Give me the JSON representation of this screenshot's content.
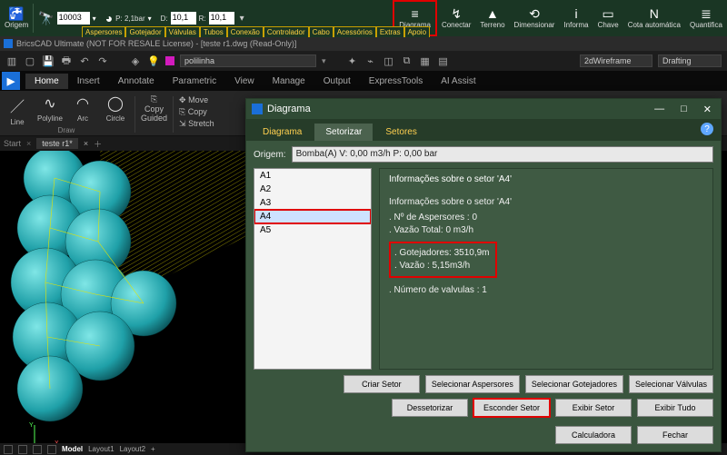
{
  "green_bar": {
    "origem": "Origem",
    "bino_value": "10003",
    "pressure_label": "P: 2,1bar",
    "d_label": "D:",
    "d_value": "10,1",
    "r_label": "R:",
    "r_value": "10,1",
    "yellow_tabs": [
      "Aspersores",
      "Gotejador",
      "Válvulas",
      "Tubos",
      "Conexão",
      "Controlador",
      "Cabo",
      "Acessórios",
      "Extras",
      "Apoio"
    ],
    "right_tools": [
      {
        "label": "Diagrama",
        "icon": "≡"
      },
      {
        "label": "Conectar",
        "icon": "↯"
      },
      {
        "label": "Terreno",
        "icon": "▲"
      },
      {
        "label": "Dimensionar",
        "icon": "⟲"
      },
      {
        "label": "Informa",
        "icon": "i"
      },
      {
        "label": "Chave",
        "icon": "▭"
      },
      {
        "label": "Cota automática",
        "icon": "N"
      },
      {
        "label": "Quantifica",
        "icon": "≣"
      }
    ]
  },
  "title_bar": "BricsCAD Ultimate (NOT FOR RESALE License) - [teste r1.dwg (Read-Only)]",
  "dark_row": {
    "layer_value": "polilinha",
    "style1": "2dWireframe",
    "style2": "Drafting"
  },
  "ribbon_tabs": [
    "Home",
    "Insert",
    "Annotate",
    "Parametric",
    "View",
    "Manage",
    "Output",
    "ExpressTools",
    "AI Assist"
  ],
  "ribbon_active": 0,
  "draw_tools": [
    {
      "label": "Line",
      "icon": "／"
    },
    {
      "label": "Polyline",
      "icon": "∿"
    },
    {
      "label": "Arc",
      "icon": "◠"
    },
    {
      "label": "Circle",
      "icon": "◯"
    }
  ],
  "draw_group_label": "Draw",
  "copy_guided": "Copy\nGuided",
  "modify_items": [
    "Move",
    "Copy",
    "Stretch"
  ],
  "doc_tabs": {
    "start": "Start",
    "file": "teste r1*"
  },
  "status_tabs": [
    "Model",
    "Layout1",
    "Layout2"
  ],
  "dialog": {
    "title": "Diagrama",
    "tabs": [
      "Diagrama",
      "Setorizar",
      "Setores"
    ],
    "active_tab": 1,
    "origem_label": "Origem:",
    "origem_value": "Bomba(A) V: 0,00 m3/h P: 0,00 bar",
    "sector_list": [
      "A1",
      "A2",
      "A3",
      "A4",
      "A5"
    ],
    "selected_sector": "A4",
    "info_header": "Informações sobre o setor 'A4'",
    "info_sub": "Informações sobre o setor 'A4'",
    "info_lines": [
      ". Nº de Aspersores : 0",
      ". Vazão Total: 0 m3/h"
    ],
    "info_highlight": [
      ". Gotejadores: 3510,9m",
      ". Vazão : 5,15m3/h"
    ],
    "info_after": ". Número de valvulas :  1",
    "btns_row1": [
      "Criar Setor",
      "Selecionar Aspersores",
      "Selecionar Gotejadores",
      "Selecionar Válvulas"
    ],
    "btns_row2": [
      "Dessetorizar",
      "Esconder Setor",
      "Exibir Setor",
      "Exibir Tudo"
    ],
    "btn_calc": "Calculadora",
    "btn_close": "Fechar"
  }
}
